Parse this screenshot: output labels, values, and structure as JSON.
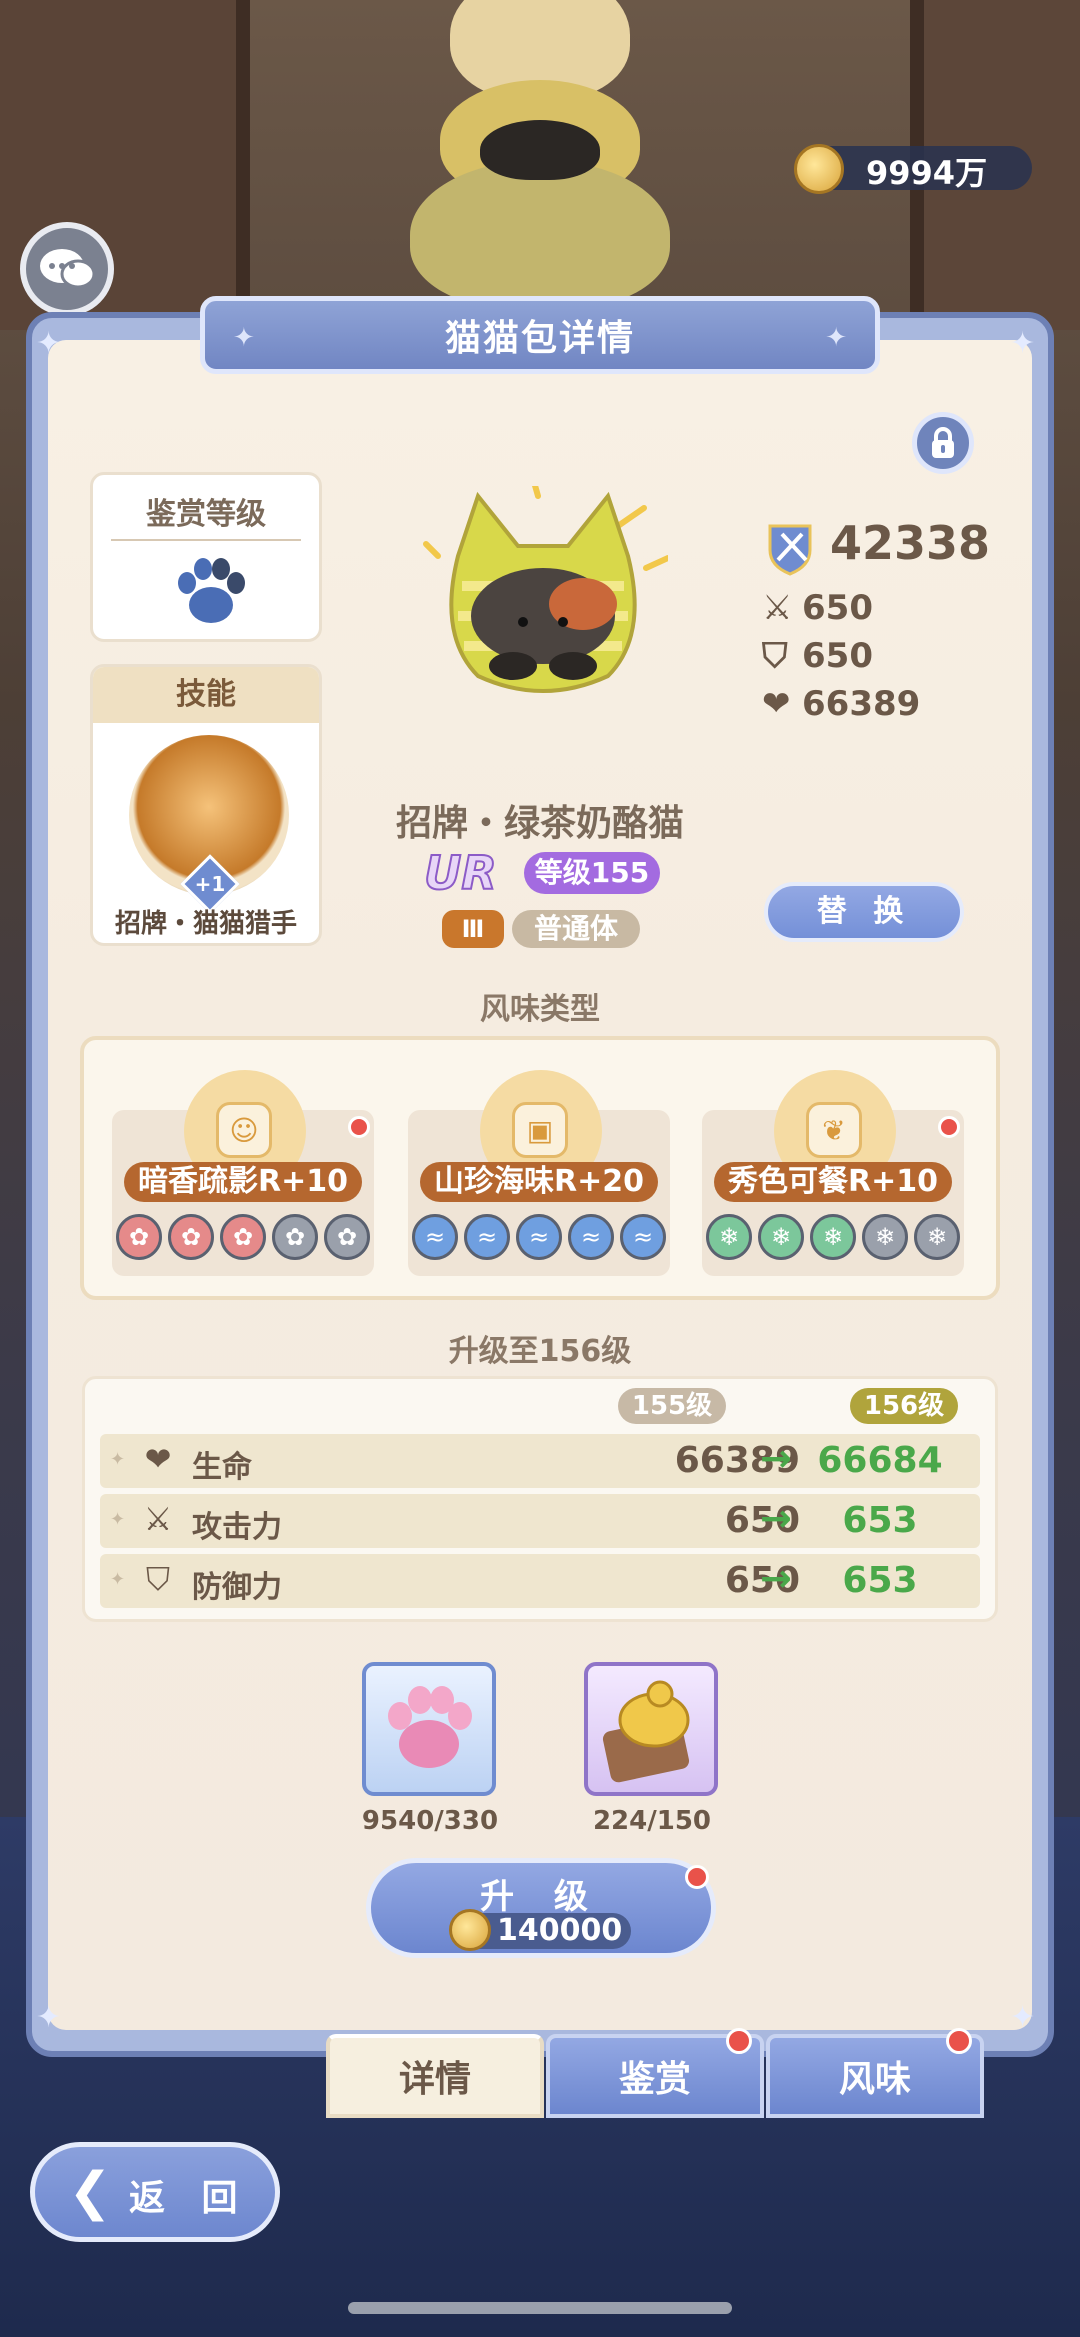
{
  "currency": {
    "amount": "9994万"
  },
  "panel": {
    "title": "猫猫包详情"
  },
  "appreciation": {
    "label": "鉴赏等级"
  },
  "skill": {
    "header": "技能",
    "plus": "+1",
    "name": "招牌・猫猫猎手"
  },
  "power": {
    "value": "42338"
  },
  "stats": {
    "attack": "650",
    "defense": "650",
    "hp": "66389"
  },
  "cat": {
    "name": "招牌・绿茶奶酪猫",
    "rarity": "UR",
    "level": "等级155",
    "tier": "Ⅲ",
    "type": "普通体"
  },
  "replace_label": "替 换",
  "flavor": {
    "title": "风味类型",
    "items": [
      {
        "label": "暗香疏影R+10",
        "icon": "cat-face-icon",
        "filled": 3,
        "total": 5,
        "color": "#e58a8a"
      },
      {
        "label": "山珍海味R+20",
        "icon": "dish-icon",
        "filled": 5,
        "total": 5,
        "color": "#6f9fe0"
      },
      {
        "label": "秀色可餐R+10",
        "icon": "fox-tail-icon",
        "filled": 3,
        "total": 5,
        "color": "#7cc79b"
      }
    ]
  },
  "upgrade": {
    "title": "升级至156级",
    "current_level": "155级",
    "next_level": "156级",
    "rows": [
      {
        "label": "生命",
        "icon": "heart-icon",
        "current": "66389",
        "next": "66684"
      },
      {
        "label": "攻击力",
        "icon": "swords-icon",
        "current": "650",
        "next": "653"
      },
      {
        "label": "防御力",
        "icon": "shield-icon",
        "current": "650",
        "next": "653"
      }
    ]
  },
  "materials": [
    {
      "icon": "pink-paw-candy-icon",
      "count": "9540/330"
    },
    {
      "icon": "gold-toast-icon",
      "count": "224/150"
    }
  ],
  "upgrade_button": {
    "label": "升 级",
    "cost": "140000"
  },
  "tabs": [
    {
      "label": "详情",
      "active": true
    },
    {
      "label": "鉴赏",
      "active": false
    },
    {
      "label": "风味",
      "active": false
    }
  ],
  "back_label": "返 回"
}
